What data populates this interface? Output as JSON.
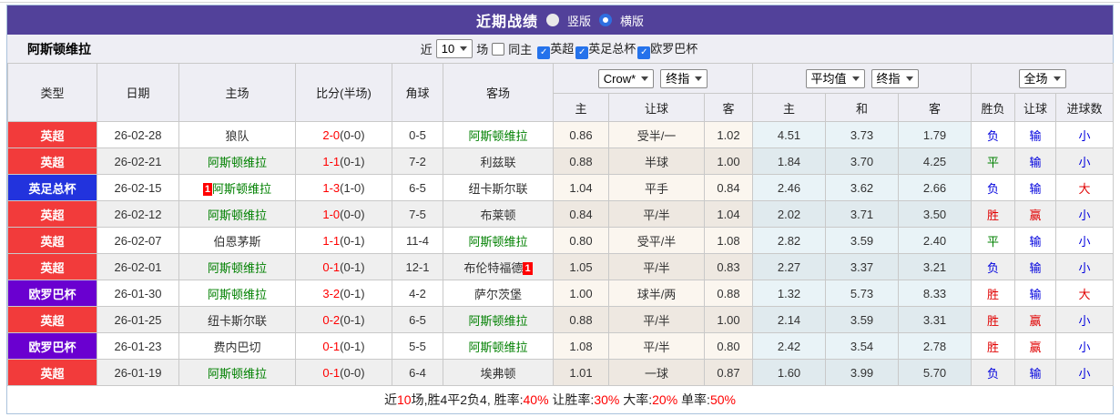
{
  "title_bar": {
    "title": "近期战绩",
    "radio_vertical": "竖版",
    "radio_horizontal": "横版",
    "selected": "横版"
  },
  "filter_bar": {
    "team_name": "阿斯顿维拉",
    "recent_label": "近",
    "match_count": "10",
    "matches_label": "场",
    "same_home_label": "同主",
    "same_home_checked": false,
    "league_filters": [
      {
        "label": "英超",
        "checked": true
      },
      {
        "label": "英足总杯",
        "checked": true
      },
      {
        "label": "欧罗巴杯",
        "checked": true
      }
    ]
  },
  "table": {
    "selects": {
      "odds_company": "Crow*",
      "odds_type1": "终指",
      "average": "平均值",
      "odds_type2": "终指",
      "scope": "全场"
    },
    "headers": {
      "type": "类型",
      "date": "日期",
      "home": "主场",
      "score": "比分(半场)",
      "corner": "角球",
      "away": "客场",
      "sub": [
        "主",
        "让球",
        "客",
        "主",
        "和",
        "客",
        "胜负",
        "让球",
        "进球数"
      ]
    },
    "rows": [
      {
        "type": "英超",
        "type_style": "epl",
        "date": "26-02-28",
        "home": "狼队",
        "home_is_villa": false,
        "home_mark": "",
        "score_ft": "2-0",
        "score_ht": "(0-0)",
        "corner": "0-5",
        "away": "阿斯顿维拉",
        "away_is_villa": true,
        "away_mark": "",
        "odds_home": "0.86",
        "handicap": "受半/一",
        "odds_away": "1.02",
        "avg_home": "4.51",
        "avg_draw": "3.73",
        "avg_away": "1.79",
        "result": "负",
        "result_c": "blue",
        "let_result": "输",
        "let_c": "blue",
        "goal_result": "小",
        "goal_c": "blue"
      },
      {
        "type": "英超",
        "type_style": "epl",
        "date": "26-02-21",
        "home": "阿斯顿维拉",
        "home_is_villa": true,
        "home_mark": "",
        "score_ft": "1-1",
        "score_ht": "(0-1)",
        "corner": "7-2",
        "away": "利兹联",
        "away_is_villa": false,
        "away_mark": "",
        "odds_home": "0.88",
        "handicap": "半球",
        "odds_away": "1.00",
        "avg_home": "1.84",
        "avg_draw": "3.70",
        "avg_away": "4.25",
        "result": "平",
        "result_c": "green",
        "let_result": "输",
        "let_c": "blue",
        "goal_result": "小",
        "goal_c": "blue"
      },
      {
        "type": "英足总杯",
        "type_style": "facup",
        "date": "26-02-15",
        "home": "阿斯顿维拉",
        "home_is_villa": true,
        "home_mark": "1",
        "score_ft": "1-3",
        "score_ht": "(1-0)",
        "corner": "6-5",
        "away": "纽卡斯尔联",
        "away_is_villa": false,
        "away_mark": "",
        "odds_home": "1.04",
        "handicap": "平手",
        "odds_away": "0.84",
        "avg_home": "2.46",
        "avg_draw": "3.62",
        "avg_away": "2.66",
        "result": "负",
        "result_c": "blue",
        "let_result": "输",
        "let_c": "blue",
        "goal_result": "大",
        "goal_c": "red"
      },
      {
        "type": "英超",
        "type_style": "epl",
        "date": "26-02-12",
        "home": "阿斯顿维拉",
        "home_is_villa": true,
        "home_mark": "",
        "score_ft": "1-0",
        "score_ht": "(0-0)",
        "corner": "7-5",
        "away": "布莱顿",
        "away_is_villa": false,
        "away_mark": "",
        "odds_home": "0.84",
        "handicap": "平/半",
        "odds_away": "1.04",
        "avg_home": "2.02",
        "avg_draw": "3.71",
        "avg_away": "3.50",
        "result": "胜",
        "result_c": "red",
        "let_result": "赢",
        "let_c": "red",
        "goal_result": "小",
        "goal_c": "blue"
      },
      {
        "type": "英超",
        "type_style": "epl",
        "date": "26-02-07",
        "home": "伯恩茅斯",
        "home_is_villa": false,
        "home_mark": "",
        "score_ft": "1-1",
        "score_ht": "(0-1)",
        "corner": "11-4",
        "away": "阿斯顿维拉",
        "away_is_villa": true,
        "away_mark": "",
        "odds_home": "0.80",
        "handicap": "受平/半",
        "odds_away": "1.08",
        "avg_home": "2.82",
        "avg_draw": "3.59",
        "avg_away": "2.40",
        "result": "平",
        "result_c": "green",
        "let_result": "输",
        "let_c": "blue",
        "goal_result": "小",
        "goal_c": "blue"
      },
      {
        "type": "英超",
        "type_style": "epl",
        "date": "26-02-01",
        "home": "阿斯顿维拉",
        "home_is_villa": true,
        "home_mark": "",
        "score_ft": "0-1",
        "score_ht": "(0-1)",
        "corner": "12-1",
        "away": "布伦特福德",
        "away_is_villa": false,
        "away_mark": "1",
        "odds_home": "1.05",
        "handicap": "平/半",
        "odds_away": "0.83",
        "avg_home": "2.27",
        "avg_draw": "3.37",
        "avg_away": "3.21",
        "result": "负",
        "result_c": "blue",
        "let_result": "输",
        "let_c": "blue",
        "goal_result": "小",
        "goal_c": "blue"
      },
      {
        "type": "欧罗巴杯",
        "type_style": "europa",
        "date": "26-01-30",
        "home": "阿斯顿维拉",
        "home_is_villa": true,
        "home_mark": "",
        "score_ft": "3-2",
        "score_ht": "(0-1)",
        "corner": "4-2",
        "away": "萨尔茨堡",
        "away_is_villa": false,
        "away_mark": "",
        "odds_home": "1.00",
        "handicap": "球半/两",
        "odds_away": "0.88",
        "avg_home": "1.32",
        "avg_draw": "5.73",
        "avg_away": "8.33",
        "result": "胜",
        "result_c": "red",
        "let_result": "输",
        "let_c": "blue",
        "goal_result": "大",
        "goal_c": "red"
      },
      {
        "type": "英超",
        "type_style": "epl",
        "date": "26-01-25",
        "home": "纽卡斯尔联",
        "home_is_villa": false,
        "home_mark": "",
        "score_ft": "0-2",
        "score_ht": "(0-1)",
        "corner": "6-5",
        "away": "阿斯顿维拉",
        "away_is_villa": true,
        "away_mark": "",
        "odds_home": "0.88",
        "handicap": "平/半",
        "odds_away": "1.00",
        "avg_home": "2.14",
        "avg_draw": "3.59",
        "avg_away": "3.31",
        "result": "胜",
        "result_c": "red",
        "let_result": "赢",
        "let_c": "red",
        "goal_result": "小",
        "goal_c": "blue"
      },
      {
        "type": "欧罗巴杯",
        "type_style": "europa",
        "date": "26-01-23",
        "home": "费内巴切",
        "home_is_villa": false,
        "home_mark": "",
        "score_ft": "0-1",
        "score_ht": "(0-1)",
        "corner": "5-5",
        "away": "阿斯顿维拉",
        "away_is_villa": true,
        "away_mark": "",
        "odds_home": "1.08",
        "handicap": "平/半",
        "odds_away": "0.80",
        "avg_home": "2.42",
        "avg_draw": "3.54",
        "avg_away": "2.78",
        "result": "胜",
        "result_c": "red",
        "let_result": "赢",
        "let_c": "red",
        "goal_result": "小",
        "goal_c": "blue"
      },
      {
        "type": "英超",
        "type_style": "epl",
        "date": "26-01-19",
        "home": "阿斯顿维拉",
        "home_is_villa": true,
        "home_mark": "",
        "score_ft": "0-1",
        "score_ht": "(0-0)",
        "corner": "6-4",
        "away": "埃弗顿",
        "away_is_villa": false,
        "away_mark": "",
        "odds_home": "1.01",
        "handicap": "一球",
        "odds_away": "0.87",
        "avg_home": "1.60",
        "avg_draw": "3.99",
        "avg_away": "5.70",
        "result": "负",
        "result_c": "blue",
        "let_result": "输",
        "let_c": "blue",
        "goal_result": "小",
        "goal_c": "blue"
      }
    ]
  },
  "footer": {
    "segments": [
      {
        "text": "近",
        "red": false
      },
      {
        "text": "10",
        "red": true
      },
      {
        "text": "场,胜4平2负4, 胜率:",
        "red": false
      },
      {
        "text": "40%",
        "red": true
      },
      {
        "text": " 让胜率:",
        "red": false
      },
      {
        "text": "30%",
        "red": true
      },
      {
        "text": " 大率:",
        "red": false
      },
      {
        "text": "20%",
        "red": true
      },
      {
        "text": " 单率:",
        "red": false
      },
      {
        "text": "50%",
        "red": true
      }
    ]
  },
  "colors": {
    "title_bar_purple": "#52419a",
    "epl_badge_red": "#f23b3b",
    "facup_badge_blue": "#2233dd",
    "europa_badge_purple": "#6a00d0",
    "villa_green": "#008000",
    "score_red": "#ff0000",
    "win_red": "#e00000",
    "lose_blue": "#0000dd",
    "draw_green": "#008000",
    "checkbox_blue": "#2572eb"
  }
}
